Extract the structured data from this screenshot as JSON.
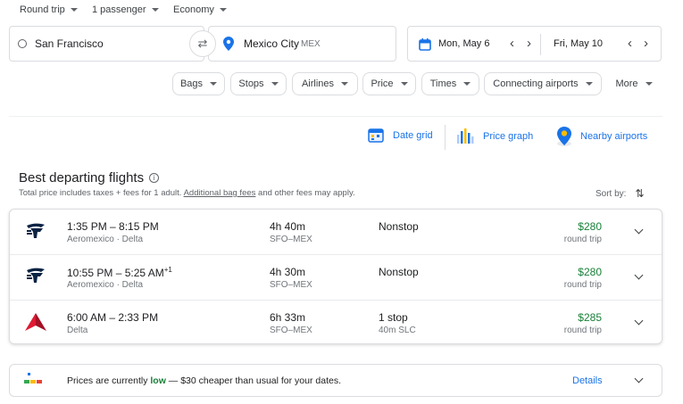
{
  "options": {
    "trip_type": "Round trip",
    "passengers": "1 passenger",
    "cabin": "Economy"
  },
  "search": {
    "origin": "San Francisco",
    "destination": "Mexico City",
    "destination_code": "MEX",
    "depart_date": "Mon, May 6",
    "return_date": "Fri, May 10"
  },
  "filters": [
    "Bags",
    "Stops",
    "Airlines",
    "Price",
    "Times",
    "Connecting airports",
    "More"
  ],
  "tools": {
    "date_grid": "Date grid",
    "price_graph": "Price graph",
    "nearby_airports": "Nearby airports"
  },
  "results": {
    "heading": "Best departing flights",
    "subtitle_before": "Total price includes taxes + fees for 1 adult. ",
    "subtitle_link": "Additional bag fees",
    "subtitle_after": " and other fees may apply.",
    "sort_label": "Sort by:"
  },
  "flights": [
    {
      "times": "1:35 PM – 8:15 PM",
      "day_offset": "",
      "carriers": "Aeromexico · Delta",
      "duration": "4h 40m",
      "route": "SFO–MEX",
      "stops": "Nonstop",
      "stop_detail": "",
      "price": "$280",
      "price_note": "round trip",
      "logo": "aeromexico-logo"
    },
    {
      "times": "10:55 PM – 5:25 AM",
      "day_offset": "+1",
      "carriers": "Aeromexico · Delta",
      "duration": "4h 30m",
      "route": "SFO–MEX",
      "stops": "Nonstop",
      "stop_detail": "",
      "price": "$280",
      "price_note": "round trip",
      "logo": "aeromexico-logo"
    },
    {
      "times": "6:00 AM – 2:33 PM",
      "day_offset": "",
      "carriers": "Delta",
      "duration": "6h 33m",
      "route": "SFO–MEX",
      "stops": "1 stop",
      "stop_detail": "40m SLC",
      "price": "$285",
      "price_note": "round trip",
      "logo": "delta-logo"
    }
  ],
  "insight": {
    "text_before": "Prices are currently ",
    "level": "low",
    "text_after": " — $30 cheaper than usual for your dates.",
    "details": "Details"
  },
  "colors": {
    "accent": "#1a73e8",
    "price_green": "#188038",
    "aeromexico": "#0b2343",
    "delta": "#c8102e"
  }
}
